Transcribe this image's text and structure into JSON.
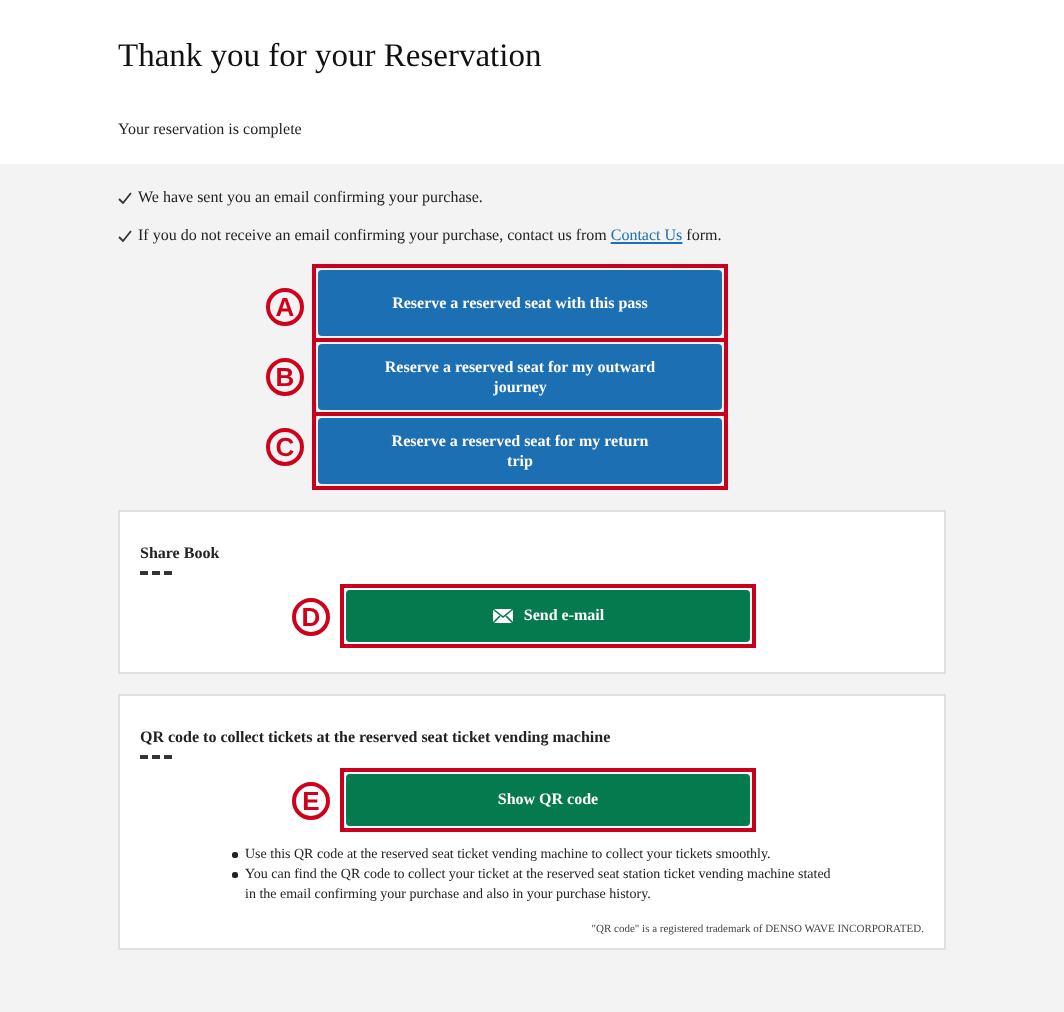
{
  "title": "Thank you for your Reservation",
  "subtitle": "Your reservation is complete",
  "notices": [
    {
      "text": "We have sent you an email confirming your purchase."
    },
    {
      "text": "If you do not receive an email confirming your purchase, contact us from ",
      "link": "Contact Us",
      "after": " form."
    }
  ],
  "reserve_buttons": [
    {
      "marker": "A",
      "label": "Reserve a reserved seat with this pass"
    },
    {
      "marker": "B",
      "label": "Reserve a reserved seat for my outward journey"
    },
    {
      "marker": "C",
      "label": "Reserve a reserved seat for my return trip"
    }
  ],
  "share_section": {
    "heading": "Share Book",
    "marker": "D",
    "button": "Send e-mail"
  },
  "qr_section": {
    "heading": "QR code to collect tickets at the reserved seat ticket vending machine",
    "marker": "E",
    "button": "Show QR code",
    "bullets": [
      "Use this QR code at the reserved seat ticket vending machine to collect your tickets smoothly.",
      "You can find the QR code to collect your ticket at the reserved seat station ticket vending machine stated in the email confirming your purchase and also in your purchase history."
    ],
    "trademark": "\"QR code\" is a registered trademark of DENSO WAVE INCORPORATED."
  }
}
